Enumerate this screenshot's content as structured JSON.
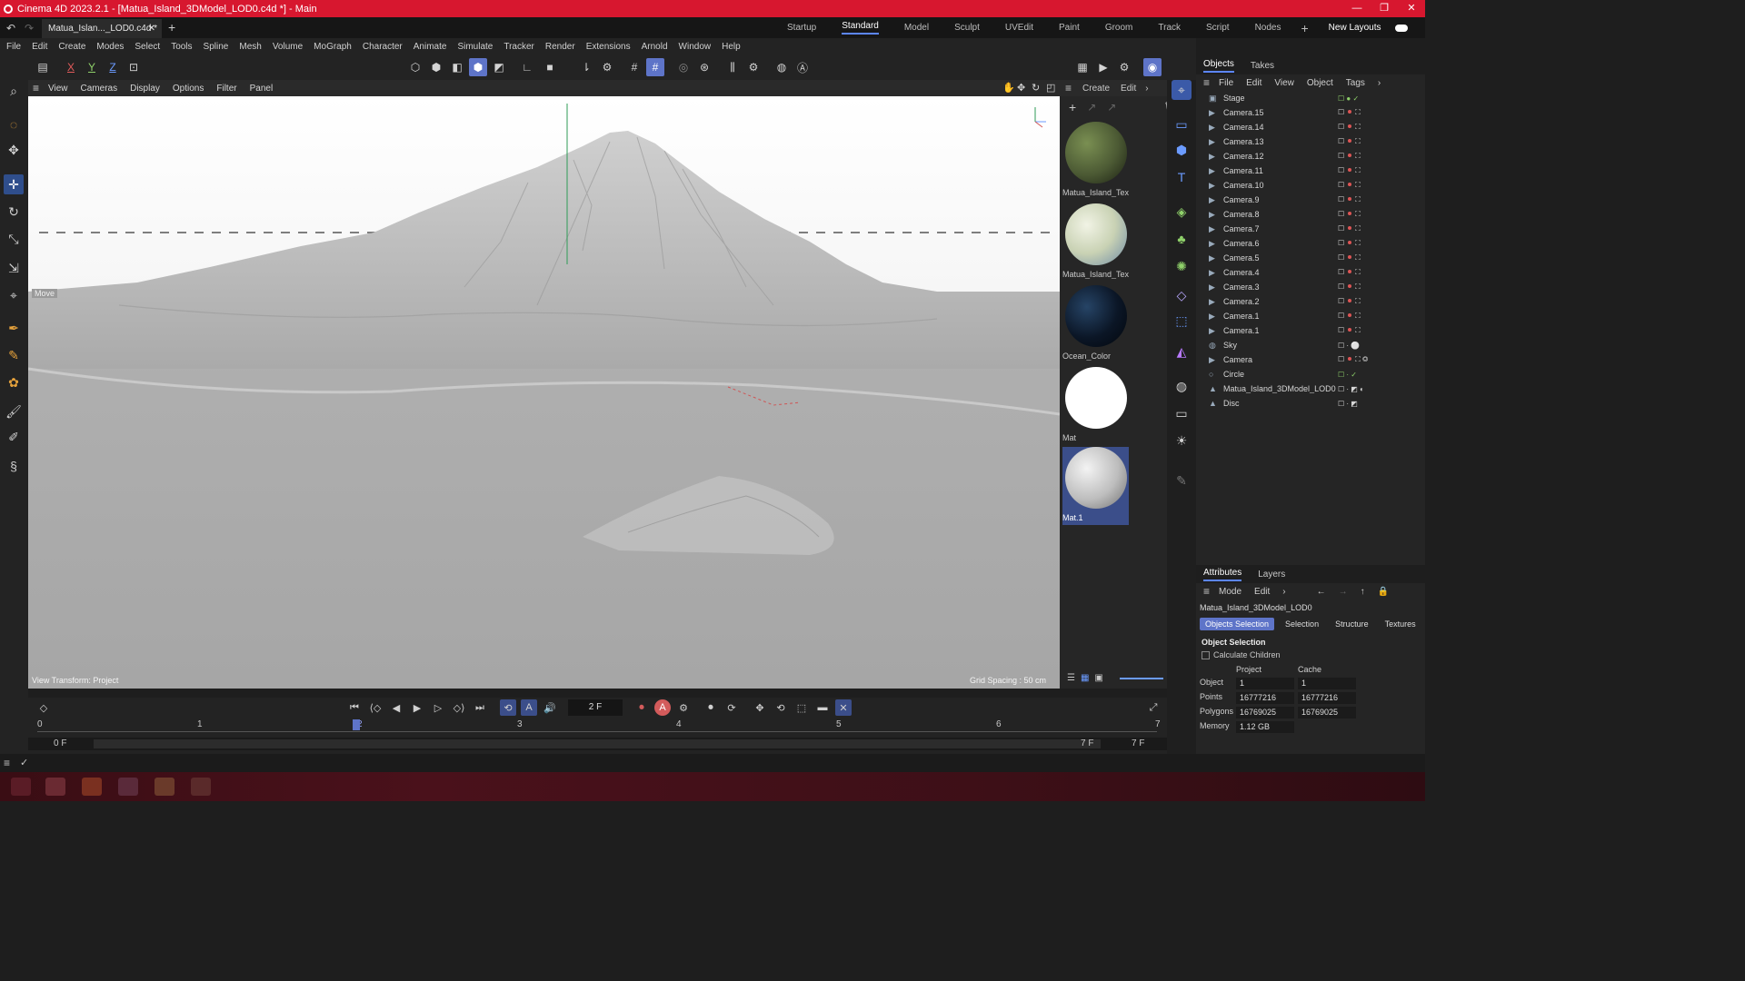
{
  "titlebar": {
    "title": "Cinema 4D 2023.2.1 - [Matua_Island_3DModel_LOD0.c4d *] - Main"
  },
  "document_tab": {
    "label": "Matua_Islan..._LOD0.c4d *"
  },
  "layouts": [
    "Startup",
    "Standard",
    "Model",
    "Sculpt",
    "UVEdit",
    "Paint",
    "Groom",
    "Track",
    "Script",
    "Nodes"
  ],
  "layouts_new": "New Layouts",
  "menu": [
    "File",
    "Edit",
    "Create",
    "Modes",
    "Select",
    "Tools",
    "Spline",
    "Mesh",
    "Volume",
    "MoGraph",
    "Character",
    "Animate",
    "Simulate",
    "Tracker",
    "Render",
    "Extensions",
    "Arnold",
    "Window",
    "Help"
  ],
  "axis": {
    "x": "X",
    "y": "Y",
    "z": "Z"
  },
  "viewport": {
    "menu": [
      "View",
      "Cameras",
      "Display",
      "Options",
      "Filter",
      "Panel"
    ],
    "tool_label": "Move",
    "view_transform": "View Transform: Project",
    "grid_spacing": "Grid Spacing : 50 cm"
  },
  "materials_menu": [
    "Create",
    "Edit"
  ],
  "materials": [
    {
      "name": "Matua_Island_Text",
      "color": "#4c5a34"
    },
    {
      "name": "Matua_Island_Text",
      "color": "#c9d2b4"
    },
    {
      "name": "Ocean_Color",
      "color": "#0b1626"
    },
    {
      "name": "Mat",
      "color": "#ffffff"
    },
    {
      "name": "Mat.1",
      "color": "#bdbdbd"
    }
  ],
  "objects_panel": {
    "tabs": [
      "Objects",
      "Takes"
    ],
    "menu": [
      "File",
      "Edit",
      "View",
      "Object",
      "Tags"
    ],
    "items": [
      "Stage",
      "Camera.15",
      "Camera.14",
      "Camera.13",
      "Camera.12",
      "Camera.11",
      "Camera.10",
      "Camera.9",
      "Camera.8",
      "Camera.7",
      "Camera.6",
      "Camera.5",
      "Camera.4",
      "Camera.3",
      "Camera.2",
      "Camera.1",
      "Camera.1",
      "Sky",
      "Camera",
      "Circle",
      "Matua_Island_3DModel_LOD0",
      "Disc"
    ]
  },
  "attributes_panel": {
    "tabs": [
      "Attributes",
      "Layers"
    ],
    "menu": [
      "Mode",
      "Edit"
    ],
    "object_name": "Matua_Island_3DModel_LOD0",
    "buttons": [
      "Objects Selection",
      "Selection",
      "Structure",
      "Textures"
    ],
    "section_title": "Object Selection",
    "calculate_children": "Calculate Children",
    "col_project": "Project",
    "col_cache": "Cache",
    "rows": [
      {
        "label": "Object",
        "project": "1",
        "cache": "1"
      },
      {
        "label": "Points",
        "project": "16777216",
        "cache": "16777216"
      },
      {
        "label": "Polygons",
        "project": "16769025",
        "cache": "16769025"
      },
      {
        "label": "Memory",
        "project": "1.12 GB",
        "cache": ""
      }
    ]
  },
  "timeline": {
    "current_frame": "2 F",
    "ruler": [
      "0",
      "1",
      "2",
      "3",
      "4",
      "5",
      "6",
      "7"
    ],
    "current_frame_value": 2,
    "start": "0 F",
    "start2": "0 F",
    "end": "7 F",
    "end2": "7 F"
  },
  "accent_color": "#5e74c8",
  "title_color": "#d7172f"
}
